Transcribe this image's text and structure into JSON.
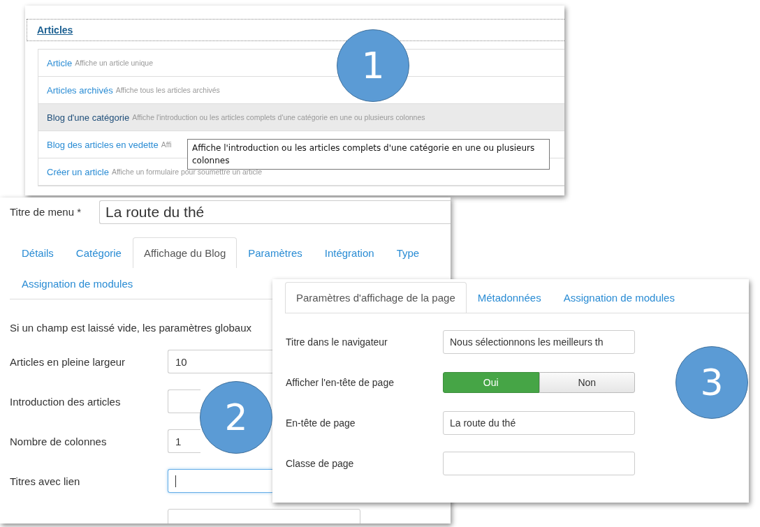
{
  "panel_1": {
    "heading": "Articles",
    "items": [
      {
        "title": "Article",
        "description": "Affiche un article unique",
        "selected": false
      },
      {
        "title": "Articles archivés",
        "description": "Affiche tous les articles archivés",
        "selected": false
      },
      {
        "title": "Blog d'une catégorie",
        "description": "Affiche l'introduction ou les articles complets d'une catégorie en une ou plusieurs colonnes",
        "selected": true
      },
      {
        "title": "Blog des articles en vedette",
        "description": "Affi",
        "selected": false
      },
      {
        "title": "Créer un article",
        "description": "Affiche un formulaire pour soumettre un article",
        "selected": false
      }
    ],
    "tooltip": "Affiche l'introduction ou les articles complets d'une catégorie en une ou plusieurs colonnes"
  },
  "panel_2": {
    "menu_title": {
      "label": "Titre de menu *",
      "value": "La route du thé"
    },
    "tabs": [
      {
        "label": "Détails",
        "selected": false
      },
      {
        "label": "Catégorie",
        "selected": false
      },
      {
        "label": "Affichage du Blog",
        "selected": true
      },
      {
        "label": "Paramètres",
        "selected": false
      },
      {
        "label": "Intégration",
        "selected": false
      },
      {
        "label": "Type",
        "selected": false
      },
      {
        "label": "Assignation de modules",
        "selected": false
      }
    ],
    "notice": "Si un champ est laissé vide, les paramètres globaux",
    "fields": [
      {
        "label": "Articles en pleine largeur",
        "value": "10",
        "focused": false
      },
      {
        "label": "Introduction des articles",
        "focused": false
      },
      {
        "label": "Nombre de colonnes",
        "value": "1",
        "focused": false
      },
      {
        "label": "Titres avec lien",
        "focused": true
      }
    ]
  },
  "panel_3": {
    "tabs": [
      {
        "label": "Paramètres d'affichage de la page",
        "selected": true
      },
      {
        "label": "Métadonnées",
        "selected": false
      },
      {
        "label": "Assignation de modules",
        "selected": false
      }
    ],
    "fields": [
      {
        "kind": "text",
        "label": "Titre dans le navigateur",
        "value": "Nous sélectionnons les meilleurs th"
      },
      {
        "kind": "toggle",
        "label": "Afficher l'en-tête de page",
        "options": [
          {
            "label": "Oui",
            "selected": true
          },
          {
            "label": "Non",
            "selected": false
          }
        ]
      },
      {
        "kind": "text",
        "label": "En-tête de page",
        "value": "La route du thé"
      },
      {
        "kind": "text",
        "label": "Classe de page"
      }
    ]
  },
  "callouts": [
    "1",
    "2",
    "3"
  ]
}
